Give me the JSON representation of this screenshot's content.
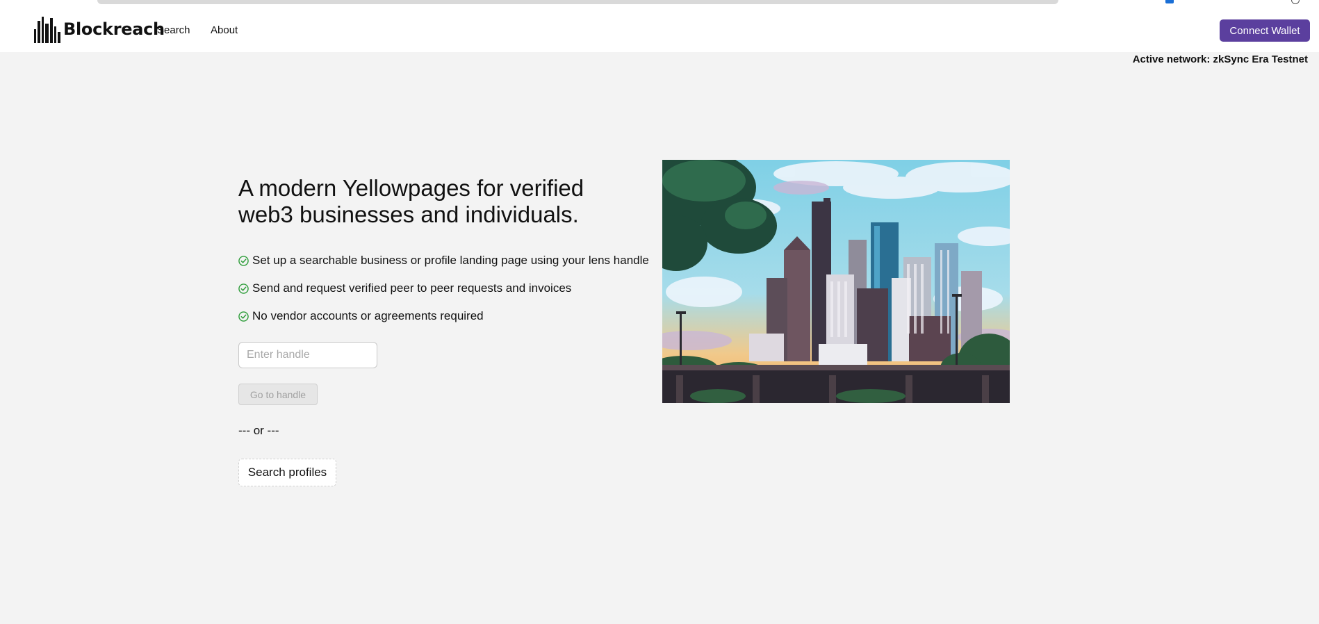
{
  "brand": {
    "name": "Blockreach",
    "logo_icon": "city-buildings-icon"
  },
  "nav": {
    "items": [
      {
        "label": "Search"
      },
      {
        "label": "About"
      }
    ]
  },
  "wallet": {
    "connect_label": "Connect Wallet",
    "network_text": "Active network: zkSync Era Testnet"
  },
  "hero": {
    "headline": "A modern Yellowpages for verified web3 businesses and individuals.",
    "features": [
      {
        "icon": "check-circle-icon",
        "text": "Set up a searchable business or profile landing page using your lens handle"
      },
      {
        "icon": "check-circle-icon",
        "text": "Send and request verified peer to peer requests and invoices"
      },
      {
        "icon": "check-circle-icon",
        "text": "No vendor accounts or agreements required"
      }
    ],
    "image": "pixel-art-city-skyline"
  },
  "handle_form": {
    "placeholder": "Enter handle",
    "value": "",
    "go_label": "Go to handle",
    "separator": "--- or ---",
    "search_label": "Search profiles"
  },
  "colors": {
    "primary": "#5b3f9e",
    "background": "#f3f3f3",
    "check": "#2e9d3a"
  }
}
